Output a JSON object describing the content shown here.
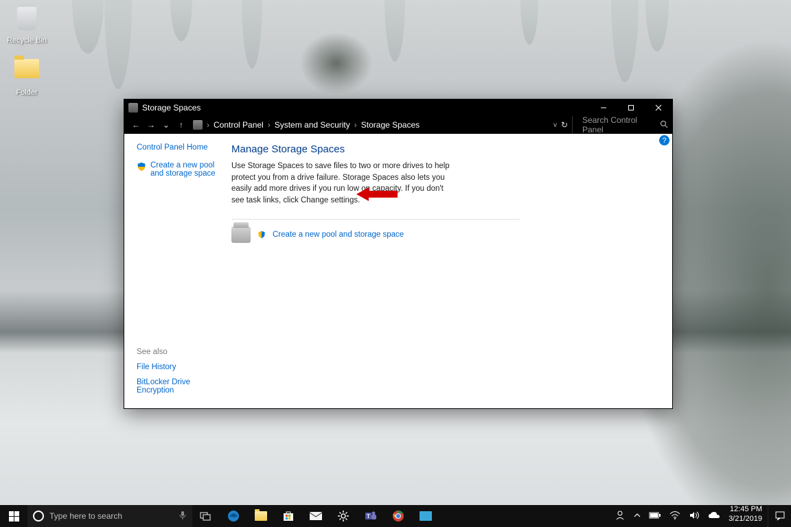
{
  "desktop": {
    "icons": [
      {
        "label": "Recycle Bin",
        "type": "recycle"
      },
      {
        "label": "Folder",
        "type": "folder"
      }
    ]
  },
  "window": {
    "title": "Storage Spaces",
    "breadcrumb": [
      "Control Panel",
      "System and Security",
      "Storage Spaces"
    ],
    "refresh_dropdown": "v",
    "search_placeholder": "Search Control Panel",
    "sidebar": {
      "home": "Control Panel Home",
      "task": "Create a new pool and storage space",
      "see_also_heading": "See also",
      "see_also": [
        "File History",
        "BitLocker Drive Encryption"
      ]
    },
    "content": {
      "heading": "Manage Storage Spaces",
      "description": "Use Storage Spaces to save files to two or more drives to help protect you from a drive failure. Storage Spaces also lets you easily add more drives if you run low on capacity. If you don't see task links, click Change settings.",
      "action_link": "Create a new pool and storage space"
    }
  },
  "taskbar": {
    "search_placeholder": "Type here to search",
    "clock": {
      "time": "12:45 PM",
      "date": "3/21/2019"
    }
  }
}
